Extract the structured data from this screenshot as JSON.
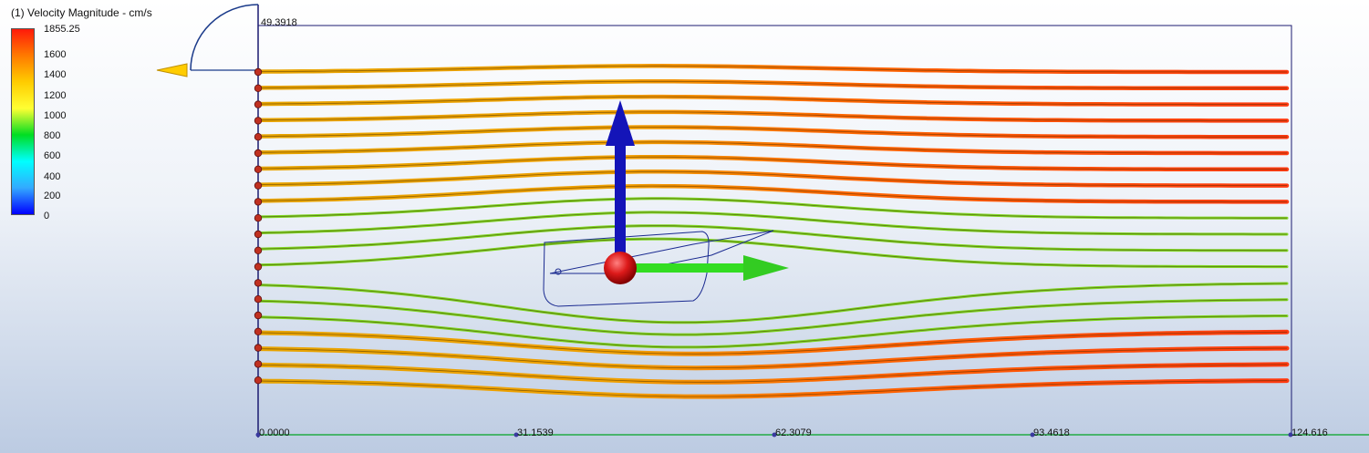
{
  "legend": {
    "title": "(1) Velocity Magnitude - cm/s",
    "ticks": [
      "1855.25",
      "1600",
      "1400",
      "1200",
      "1000",
      "800",
      "600",
      "400",
      "200",
      "0"
    ],
    "gradient": [
      "#ff1a0a",
      "#ff7a00",
      "#ffcc00",
      "#ffff33",
      "#00dd22",
      "#00ffff",
      "#33aaff",
      "#0000ff"
    ]
  },
  "axes": {
    "y_max_label": "49.3918",
    "x_tick_labels": [
      "0.0000",
      "31.1539",
      "62.3079",
      "93.4618",
      "124.616"
    ]
  },
  "colors": {
    "domain_border": "#1a1a70",
    "seed_point": "#c03020",
    "y_axis_arrow": "#1414b8",
    "x_axis_arrow": "#33dd22",
    "origin_sphere": "#cc1010",
    "triad_arrow": "#ffcc00",
    "triad_arc": "#1a3a8a"
  }
}
